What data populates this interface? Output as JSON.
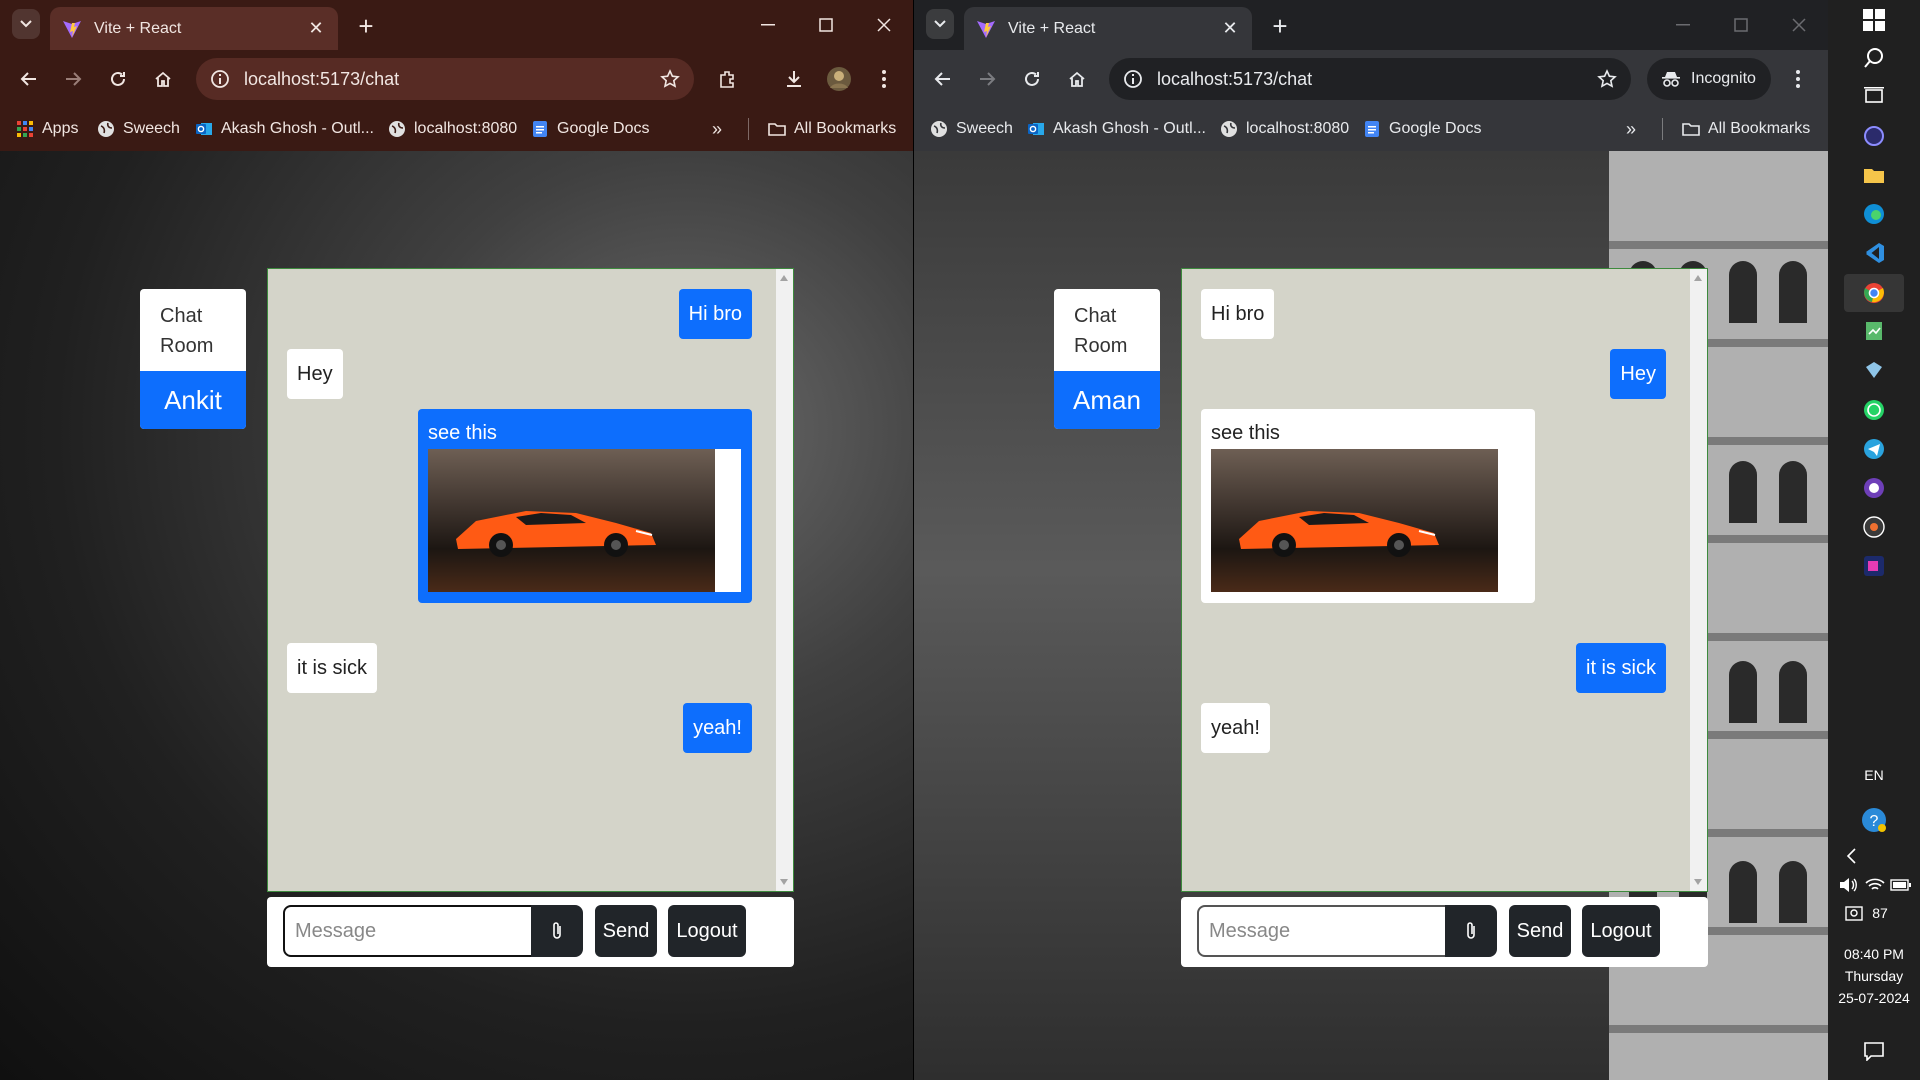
{
  "left_window": {
    "tab_title": "Vite + React",
    "url": "localhost:5173/chat",
    "bookmarks": [
      "Apps",
      "Sweech",
      "Akash Ghosh - Outl...",
      "localhost:8080",
      "Google Docs"
    ],
    "all_bookmarks": "All Bookmarks",
    "sidebar_label": "Chat Room",
    "username": "Ankit",
    "messages": [
      {
        "text": "Hi bro",
        "side": "out"
      },
      {
        "text": "Hey",
        "side": "in"
      },
      {
        "text": "see this",
        "side": "out",
        "image": "orange-sports-car"
      },
      {
        "text": "it is sick",
        "side": "in"
      },
      {
        "text": "yeah!",
        "side": "out"
      }
    ],
    "message_placeholder": "Message",
    "send_label": "Send",
    "logout_label": "Logout"
  },
  "right_window": {
    "tab_title": "Vite + React",
    "url": "localhost:5173/chat",
    "incognito_label": "Incognito",
    "bookmarks": [
      "Sweech",
      "Akash Ghosh - Outl...",
      "localhost:8080",
      "Google Docs"
    ],
    "all_bookmarks": "All Bookmarks",
    "sidebar_label": "Chat Room",
    "username": "Aman",
    "messages": [
      {
        "text": "Hi bro",
        "side": "in"
      },
      {
        "text": "Hey",
        "side": "out"
      },
      {
        "text": "see this",
        "side": "in",
        "image": "orange-sports-car"
      },
      {
        "text": "it is sick",
        "side": "out"
      },
      {
        "text": "yeah!",
        "side": "in"
      }
    ],
    "message_placeholder": "Message",
    "send_label": "Send",
    "logout_label": "Logout"
  },
  "taskbar": {
    "language": "EN",
    "battery": "87",
    "time": "08:40 PM",
    "day": "Thursday",
    "date": "25-07-2024"
  },
  "colors": {
    "accent_blue": "#0d6efd",
    "chat_bg": "#d4d4c9",
    "dark_button": "#212529",
    "left_titlebar": "#3a1a14",
    "incognito_toolbar": "#35363a"
  }
}
